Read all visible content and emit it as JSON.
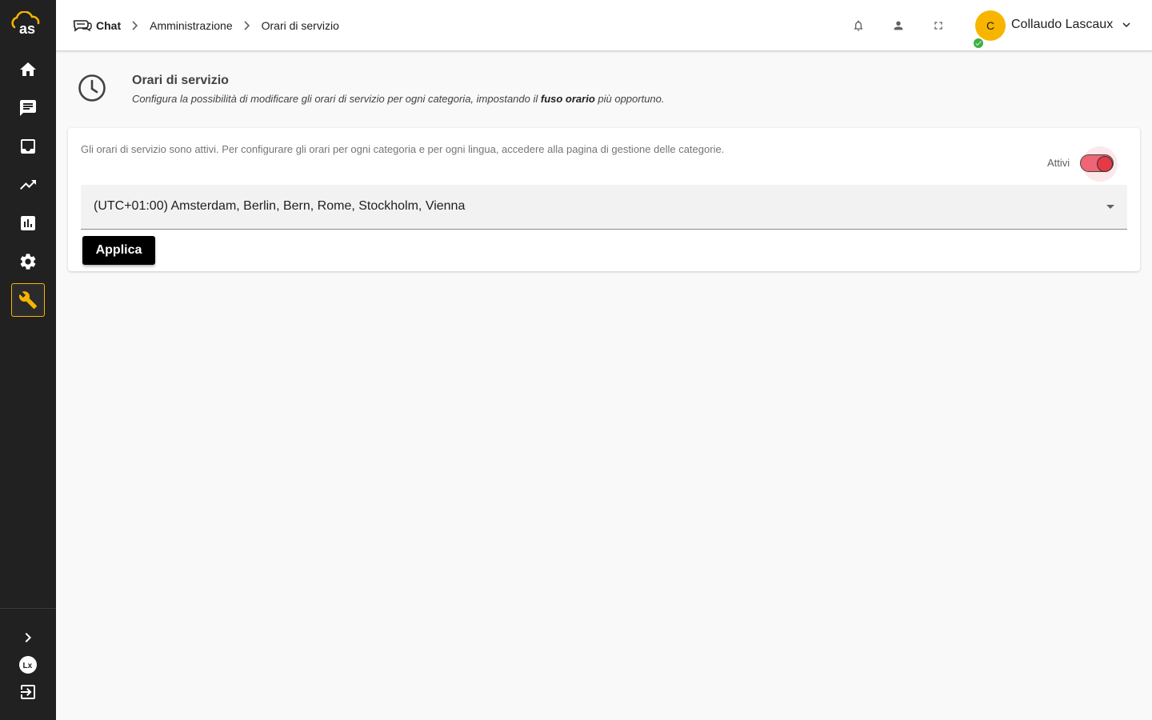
{
  "sidebar": {
    "logo_text": "as",
    "items": [
      {
        "name": "home",
        "icon": "home-icon"
      },
      {
        "name": "chat",
        "icon": "chat-icon"
      },
      {
        "name": "inbox",
        "icon": "inbox-icon"
      },
      {
        "name": "trending",
        "icon": "trending-up-icon"
      },
      {
        "name": "reports",
        "icon": "bar-chart-icon"
      },
      {
        "name": "settings",
        "icon": "gear-icon"
      },
      {
        "name": "admin",
        "icon": "wrench-icon",
        "active": true
      }
    ],
    "bottom": [
      {
        "name": "expand",
        "icon": "chevron-right-icon"
      },
      {
        "name": "lascaux",
        "icon": "lascaux-logo-icon"
      },
      {
        "name": "logout",
        "icon": "logout-icon"
      }
    ],
    "accent_color": "#f7b500"
  },
  "header": {
    "breadcrumb": [
      "Chat",
      "Amministrazione",
      "Orari di servizio"
    ],
    "icons": [
      "bell-icon",
      "person-icon",
      "fullscreen-icon"
    ],
    "user": {
      "initial": "C",
      "name": "Collaudo Lascaux",
      "status": "online"
    }
  },
  "page": {
    "title": "Orari di servizio",
    "subtitle_pre": "Configura la possibilità di modificare gli orari di servizio per ogni categoria, impostando il ",
    "subtitle_bold": "fuso orario",
    "subtitle_post": " più opportuno."
  },
  "card": {
    "info": "Gli orari di servizio sono attivi. Per configurare gli orari per ogni categoria e per ogni lingua, accedere alla pagina di gestione delle categorie.",
    "toggle_label": "Attivi",
    "toggle_on": true,
    "timezone": "(UTC+01:00) Amsterdam, Berlin, Bern, Rome, Stockholm, Vienna",
    "apply_label": "Applica"
  }
}
